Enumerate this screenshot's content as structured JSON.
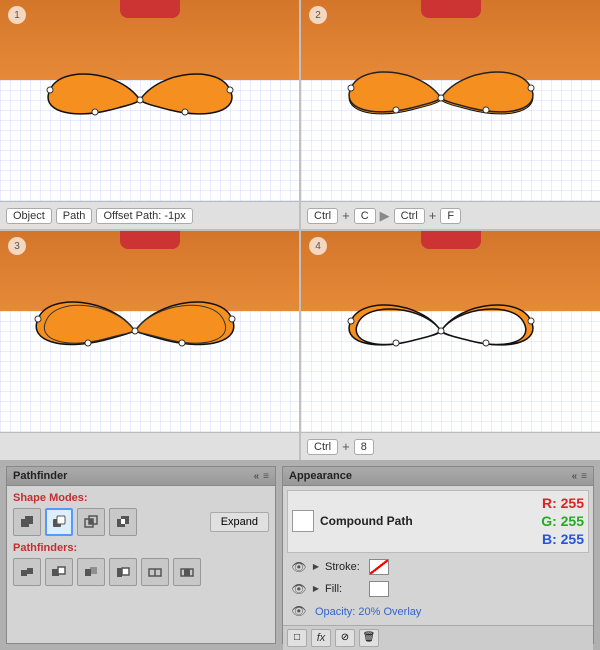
{
  "tutorial": {
    "panels": [
      {
        "id": "panel1",
        "step": "1",
        "bar": {
          "items": [
            {
              "type": "kbd",
              "label": "Object"
            },
            {
              "type": "kbd",
              "label": "Path"
            },
            {
              "type": "kbd",
              "label": "Offset Path: -1px"
            }
          ]
        }
      },
      {
        "id": "panel2",
        "step": "2",
        "bar": {
          "items": [
            {
              "type": "kbd",
              "label": "Ctrl"
            },
            {
              "type": "plus"
            },
            {
              "type": "kbd",
              "label": "C"
            },
            {
              "type": "arrow"
            },
            {
              "type": "kbd",
              "label": "Ctrl"
            },
            {
              "type": "plus"
            },
            {
              "type": "kbd",
              "label": "F"
            }
          ]
        }
      },
      {
        "id": "panel3",
        "step": "3",
        "bar": {
          "items": []
        }
      },
      {
        "id": "panel4",
        "step": "4",
        "bar": {
          "items": [
            {
              "type": "kbd",
              "label": "Ctrl"
            },
            {
              "type": "plus"
            },
            {
              "type": "kbd",
              "label": "8"
            }
          ]
        }
      }
    ]
  },
  "pathfinder": {
    "title": "Pathfinder",
    "collapse_icon": "«",
    "menu_icon": "≡",
    "shape_modes_label": "Shape Modes:",
    "expand_label": "Expand",
    "pathfinders_label": "Pathfinders:"
  },
  "appearance": {
    "title": "Appearance",
    "collapse_icon": "«",
    "menu_icon": "≡",
    "compound_path_label": "Compound Path",
    "stroke_label": "Stroke:",
    "fill_label": "Fill:",
    "opacity_label": "Opacity: 20% Overlay",
    "rgb": {
      "r_label": "R: 255",
      "g_label": "G: 255",
      "b_label": "B: 255"
    }
  }
}
